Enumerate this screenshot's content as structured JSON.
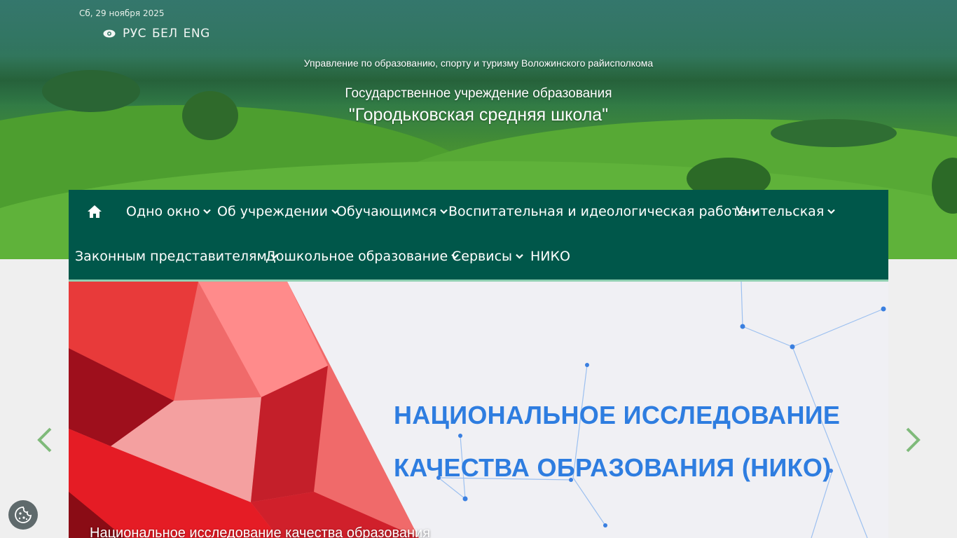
{
  "top_bar": {
    "date": "Сб, 29 ноября 2025",
    "languages": [
      "РУС",
      "БЕЛ",
      "ENG"
    ]
  },
  "header": {
    "subtitle": "Управление по образованию, спорту и туризму Воложинского райисполкома",
    "org_line": "Государственное учреждение образования",
    "school_name": "\"Городьковская средняя школа\""
  },
  "nav": {
    "row1": [
      {
        "label": "Одно окно",
        "dropdown": true
      },
      {
        "label": "Об учреждении",
        "dropdown": true
      },
      {
        "label": "Обучающимся",
        "dropdown": true
      },
      {
        "label": "Воспитательная и идеологическая работа",
        "dropdown": true
      },
      {
        "label": "Учительская",
        "dropdown": true
      }
    ],
    "row2": [
      {
        "label": "Законным представителям",
        "dropdown": true
      },
      {
        "label": "Дошкольное образование",
        "dropdown": true
      },
      {
        "label": "Сервисы",
        "dropdown": true
      },
      {
        "label": "НИКО",
        "dropdown": false
      }
    ]
  },
  "slider": {
    "title_line1": "НАЦИОНАЛЬНОЕ ИССЛЕДОВАНИЕ",
    "title_line2": "КАЧЕСТВА ОБРАЗОВАНИЯ (НИКО)",
    "caption": "Национальное исследование качества образования"
  },
  "colors": {
    "nav_bg": "#00574a",
    "nav_accent": "#8fcfb1",
    "slide_title": "#2e7de0",
    "arrow": "#7fba7a"
  }
}
